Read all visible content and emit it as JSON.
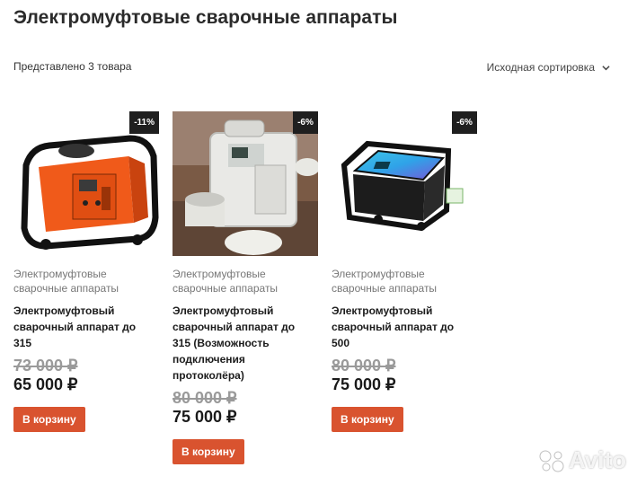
{
  "page": {
    "title": "Электромуфтовые сварочные аппараты",
    "result_count": "Представлено 3 товара",
    "sort_label": "Исходная сортировка"
  },
  "products": [
    {
      "badge": "-11%",
      "category": "Электромуфтовые сварочные аппараты",
      "name": "Электромуфтовый сварочный аппарат до 315",
      "old_price": "73 000 ₽",
      "price": "65 000 ₽",
      "cart_label": "В корзину",
      "image_icon": "orange-welding-machine-icon"
    },
    {
      "badge": "-6%",
      "category": "Электромуфтовые сварочные аппараты",
      "name": "Электромуфтовый сварочный аппарат до 315 (Возможность подключения протоколёра)",
      "old_price": "80 000 ₽",
      "price": "75 000 ₽",
      "cart_label": "В корзину",
      "image_icon": "white-welding-machine-icon"
    },
    {
      "badge": "-6%",
      "category": "Электромуфтовые сварочные аппараты",
      "name": "Электромуфтовый сварочный аппарат до 500",
      "old_price": "80 000 ₽",
      "price": "75 000 ₽",
      "cart_label": "В корзину",
      "image_icon": "blue-welding-machine-icon"
    }
  ],
  "watermark": {
    "text": "Avito"
  },
  "colors": {
    "cart_button": "#d9532f",
    "badge_bg": "#1f1f1f"
  }
}
